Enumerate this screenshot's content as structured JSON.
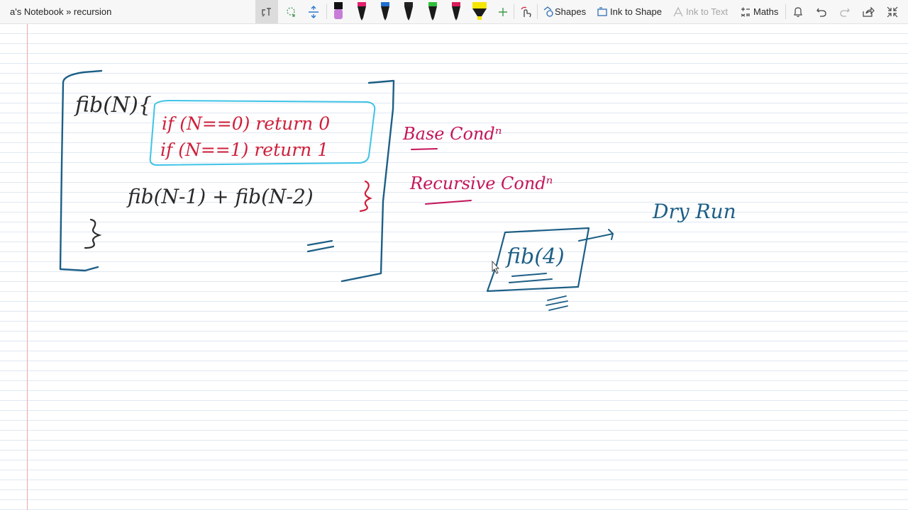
{
  "breadcrumb": "a's Notebook » recursion",
  "toolbar": {
    "shapes_label": "Shapes",
    "ink_to_shape_label": "Ink to Shape",
    "ink_to_text_label": "Ink to Text",
    "maths_label": "Maths",
    "pens": [
      {
        "name": "black-pen",
        "color": "#111111",
        "cap": "#c77dd8"
      },
      {
        "name": "pink-pen",
        "color": "#1b1b1b",
        "cap": "#e3206d"
      },
      {
        "name": "blue-pen",
        "color": "#1b1b1b",
        "cap": "#1f6fd1"
      },
      {
        "name": "dark-pen",
        "color": "#1b1b1b",
        "cap": "#222222"
      },
      {
        "name": "green-pen",
        "color": "#1b1b1b",
        "cap": "#2fbf3a"
      },
      {
        "name": "magenta-pen",
        "color": "#1b1b1b",
        "cap": "#d91b5c"
      },
      {
        "name": "yellow-highlighter",
        "color": "#1b1b1b",
        "cap": "#f6e500"
      }
    ]
  },
  "ink": {
    "fn_header": "fib(N){",
    "base_line_1": "if (N==0) return 0",
    "base_line_2": "if (N==1) return 1",
    "recursive_line": "fib(N-1) + fib(N-2)",
    "close_brace": "}",
    "base_cond": "Base Condⁿ",
    "recursive_cond": "Recursive Condⁿ",
    "dry_run": "Dry Run",
    "fib4": "fib(4)",
    "colors": {
      "blue_ink": "#1d5f86",
      "red_ink": "#cf1f3a",
      "magenta_ink": "#c4155a",
      "cyan_box": "#3ec3e6",
      "dark_ink": "#2a2a2a"
    }
  }
}
